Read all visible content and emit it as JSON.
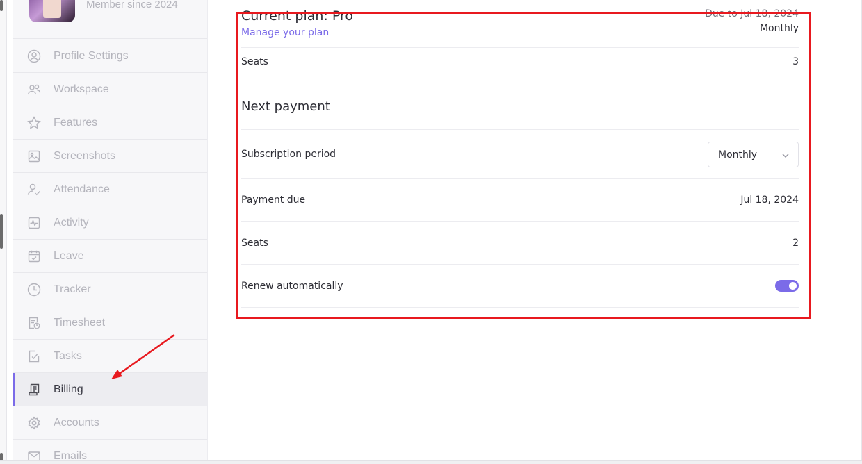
{
  "profile": {
    "member_since": "Member since 2024"
  },
  "sidebar": {
    "items": [
      {
        "label": "Profile Settings",
        "icon": "user-circle-icon",
        "active": false
      },
      {
        "label": "Workspace",
        "icon": "users-icon",
        "active": false
      },
      {
        "label": "Features",
        "icon": "star-icon",
        "active": false
      },
      {
        "label": "Screenshots",
        "icon": "image-icon",
        "active": false
      },
      {
        "label": "Attendance",
        "icon": "user-check-icon",
        "active": false
      },
      {
        "label": "Activity",
        "icon": "activity-icon",
        "active": false
      },
      {
        "label": "Leave",
        "icon": "calendar-check-icon",
        "active": false
      },
      {
        "label": "Tracker",
        "icon": "clock-icon",
        "active": false
      },
      {
        "label": "Timesheet",
        "icon": "timesheet-icon",
        "active": false
      },
      {
        "label": "Tasks",
        "icon": "task-check-icon",
        "active": false
      },
      {
        "label": "Billing",
        "icon": "receipt-icon",
        "active": true
      },
      {
        "label": "Accounts",
        "icon": "gear-icon",
        "active": false
      },
      {
        "label": "Emails",
        "icon": "mail-icon",
        "active": false
      }
    ]
  },
  "plan": {
    "title": "Current plan: Pro",
    "manage_link": "Manage your plan",
    "due_to": "Due to Jul 18, 2024",
    "period": "Monthly",
    "seats_label": "Seats",
    "seats_value": "3"
  },
  "next_payment": {
    "title": "Next payment",
    "subscription_period_label": "Subscription period",
    "subscription_period_value": "Monthly",
    "payment_due_label": "Payment due",
    "payment_due_value": "Jul 18, 2024",
    "seats_label": "Seats",
    "seats_value": "2",
    "renew_label": "Renew automatically",
    "renew_enabled": true
  },
  "colors": {
    "accent": "#7b6be8",
    "annotation": "#e8191f"
  }
}
